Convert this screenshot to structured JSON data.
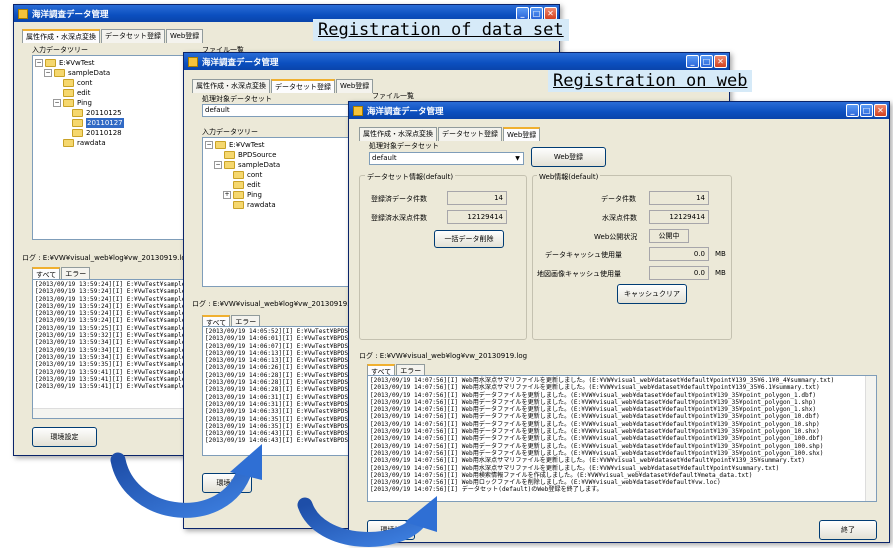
{
  "app_title": "海洋調査データ管理",
  "tabs": [
    "属性作成・水深点変換",
    "データセット登録",
    "Web登録"
  ],
  "captions": {
    "dataset": "Registration of data set",
    "web": "Registration on web"
  },
  "win1": {
    "input_tree_label": "入力データツリー",
    "file_list_label": "ファイル一覧",
    "tree": [
      {
        "label": "E:¥VwTest",
        "indent": 0,
        "exp": "−"
      },
      {
        "label": "sampleData",
        "indent": 1,
        "exp": "−"
      },
      {
        "label": "cont",
        "indent": 2
      },
      {
        "label": "edit",
        "indent": 2
      },
      {
        "label": "Ping",
        "indent": 2,
        "exp": "−"
      },
      {
        "label": "20110125",
        "indent": 3
      },
      {
        "label": "20110127",
        "indent": 3,
        "selected": true
      },
      {
        "label": "20110128",
        "indent": 3
      },
      {
        "label": "rawdata",
        "indent": 2
      }
    ],
    "log_label": "ログ : E:¥VW¥visual_web¥log¥vw_20130919.log",
    "log_tabs": [
      "すべて",
      "エラー"
    ],
    "log_lines": [
      "[2013/09/19 13:59:24][I] E:¥VwTest¥sampleDat",
      "[2013/09/19 13:59:24][I] E:¥VwTest¥sampleDat",
      "[2013/09/19 13:59:24][I] E:¥VwTest¥sampleDat",
      "[2013/09/19 13:59:24][I] E:¥VwTest¥sampleDat",
      "[2013/09/19 13:59:24][I] E:¥VwTest¥sampleDat",
      "[2013/09/19 13:59:24][I] E:¥VwTest¥sampleDat",
      "[2013/09/19 13:59:25][I] E:¥VwTest¥sampleDat",
      "[2013/09/19 13:59:32][I] E:¥VwTest¥sampleDat",
      "[2013/09/19 13:59:34][I] E:¥VwTest¥sampleDat",
      "[2013/09/19 13:59:34][I] E:¥VwTest¥sampleDat",
      "[2013/09/19 13:59:34][I] E:¥VwTest¥sampleDat",
      "[2013/09/19 13:59:35][I] E:¥VwTest¥sampleDat",
      "[2013/09/19 13:59:41][I] E:¥VwTest¥sampleDat",
      "[2013/09/19 13:59:41][I] E:¥VwTest¥sampleDat",
      "[2013/09/19 13:59:41][I] E:¥VwTest¥sampleDat"
    ],
    "env_button": "環境設定"
  },
  "win2": {
    "target_label": "処理対象データセット",
    "target_value": "default",
    "input_tree_label": "入力データツリー",
    "file_list_label": "ファイル一覧",
    "tree": [
      {
        "label": "E:¥VwTest",
        "indent": 0,
        "exp": "−"
      },
      {
        "label": "BPDSource",
        "indent": 1
      },
      {
        "label": "sampleData",
        "indent": 1,
        "exp": "−"
      },
      {
        "label": "cont",
        "indent": 2
      },
      {
        "label": "edit",
        "indent": 2
      },
      {
        "label": "Ping",
        "indent": 2,
        "exp": "+"
      },
      {
        "label": "rawdata",
        "indent": 2
      }
    ],
    "log_label": "ログ : E:¥VW¥visual_web¥log¥vw_20130919.log",
    "log_tabs": [
      "すべて",
      "エラー"
    ],
    "log_lines": [
      "[2013/09/19 14:05:52][I] E:¥VwTest¥BPDSou",
      "[2013/09/19 14:06:01][I] E:¥VwTest¥BPDSou",
      "[2013/09/19 14:06:07][I] E:¥VwTest¥BPDSou",
      "[2013/09/19 14:06:13][I] E:¥VwTest¥BPDSou",
      "[2013/09/19 14:06:13][I] E:¥VwTest¥BPDSou",
      "[2013/09/19 14:06:26][I] E:¥VwTest¥BPDSou",
      "[2013/09/19 14:06:28][I] E:¥VwTest¥BPDSou",
      "[2013/09/19 14:06:28][I] E:¥VwTest¥BPDSou",
      "[2013/09/19 14:06:28][I] E:¥VwTest¥BPDSou",
      "[2013/09/19 14:06:31][I] E:¥VwTest¥BPDSou",
      "[2013/09/19 14:06:31][I] E:¥VwTest¥BPDSou",
      "[2013/09/19 14:06:33][I] E:¥VwTest¥BPDSou",
      "[2013/09/19 14:06:35][I] E:¥VwTest¥BPDSou",
      "[2013/09/19 14:06:35][I] E:¥VwTest¥BPDSou",
      "[2013/09/19 14:06:43][I] E:¥VwTest¥BPDSou",
      "[2013/09/19 14:06:43][I] E:¥VwTest¥BPDSou"
    ],
    "env_button": "環境設"
  },
  "win3": {
    "target_label": "処理対象データセット",
    "target_value": "default",
    "web_register_button": "Web登録",
    "dataset_group_label": "データセット情報(default)",
    "registered_data_label": "登録済データ件数",
    "registered_data_value": "14",
    "registered_points_label": "登録済水深点件数",
    "registered_points_value": "12129414",
    "bulk_delete_button": "一括データ削除",
    "web_group_label": "Web情報(default)",
    "data_count_label": "データ件数",
    "data_count_value": "14",
    "depth_points_label": "水深点件数",
    "depth_points_value": "12129414",
    "publish_status_label": "Web公開状況",
    "publish_status_value": "公開中",
    "data_cache_label": "データキャッシュ使用量",
    "data_cache_value": "0.0",
    "map_cache_label": "地図画像キャッシュ使用量",
    "map_cache_value": "0.0",
    "unit_mb": "MB",
    "cache_clear_button": "キャッシュクリア",
    "log_label": "ログ : E:¥VW¥visual_web¥log¥vw_20130919.log",
    "log_tabs": [
      "すべて",
      "エラー"
    ],
    "log_lines": [
      "[2013/09/19 14:07:56][I] Web用水深点サマリファイルを更新しました。(E:¥VW¥visual_web¥dataset¥default¥point¥139_35¥6.1¥0_4¥summary.txt)",
      "[2013/09/19 14:07:56][I] Web用水深点サマリファイルを更新しました。(E:¥VW¥visual_web¥dataset¥default¥point¥139_35¥6.1¥summary.txt)",
      "[2013/09/19 14:07:56][I] Web用データファイルを更新しました。(E:¥VW¥visual_web¥dataset¥default¥point¥139_35¥point_polygon_1.dbf)",
      "[2013/09/19 14:07:56][I] Web用データファイルを更新しました。(E:¥VW¥visual_web¥dataset¥default¥point¥139_35¥point_polygon_1.shp)",
      "[2013/09/19 14:07:56][I] Web用データファイルを更新しました。(E:¥VW¥visual_web¥dataset¥default¥point¥139_35¥point_polygon_1.shx)",
      "[2013/09/19 14:07:56][I] Web用データファイルを更新しました。(E:¥VW¥visual_web¥dataset¥default¥point¥139_35¥point_polygon_10.dbf)",
      "[2013/09/19 14:07:56][I] Web用データファイルを更新しました。(E:¥VW¥visual_web¥dataset¥default¥point¥139_35¥point_polygon_10.shp)",
      "[2013/09/19 14:07:56][I] Web用データファイルを更新しました。(E:¥VW¥visual_web¥dataset¥default¥point¥139_35¥point_polygon_10.shx)",
      "[2013/09/19 14:07:56][I] Web用データファイルを更新しました。(E:¥VW¥visual_web¥dataset¥default¥point¥139_35¥point_polygon_100.dbf)",
      "[2013/09/19 14:07:56][I] Web用データファイルを更新しました。(E:¥VW¥visual_web¥dataset¥default¥point¥139_35¥point_polygon_100.shp)",
      "[2013/09/19 14:07:56][I] Web用データファイルを更新しました。(E:¥VW¥visual_web¥dataset¥default¥point¥139_35¥point_polygon_100.shx)",
      "[2013/09/19 14:07:56][I] Web用水深点サマリファイルを更新しました。(E:¥VW¥visual_web¥dataset¥default¥point¥139_35¥summary.txt)",
      "[2013/09/19 14:07:56][I] Web用水深点サマリファイルを更新しました。(E:¥VW¥visual_web¥dataset¥default¥point¥summary.txt)",
      "[2013/09/19 14:07:56][I] Web用検索情報ファイルを作成しました。(E:¥VW¥visual_web¥dataset¥default¥meta_data.txt)",
      "[2013/09/19 14:07:56][I] Web用ロックファイルを削除しました。(E:¥VW¥visual_web¥dataset¥default¥vw.loc)",
      "[2013/09/19 14:07:56][I] データセット(default)のWeb登録を終了します。"
    ],
    "env_button": "環境設",
    "exit_button": "終了"
  }
}
